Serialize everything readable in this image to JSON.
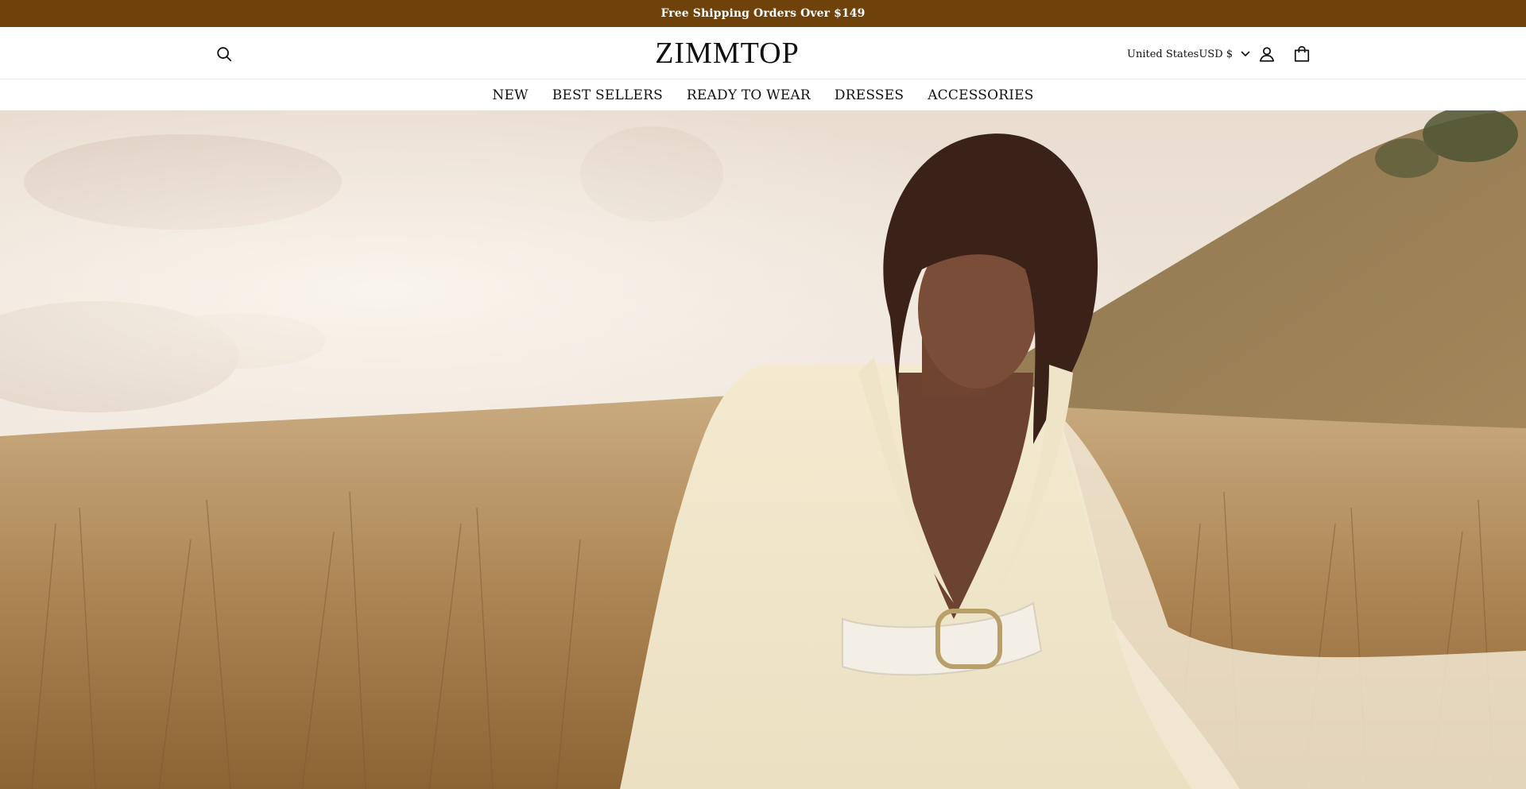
{
  "announcement": {
    "text": "Free Shipping Orders Over $149"
  },
  "header": {
    "logo": "ZIMMTOP",
    "locale": {
      "country": "United States",
      "currency": "USD $"
    },
    "icons": {
      "search": "search-icon",
      "account": "user-icon",
      "cart": "shopping-bag-icon",
      "dropdown": "chevron-down-icon"
    }
  },
  "nav": {
    "items": [
      {
        "label": "NEW"
      },
      {
        "label": "BEST SELLERS"
      },
      {
        "label": "READY TO WEAR"
      },
      {
        "label": "DRESSES"
      },
      {
        "label": "ACCESSORIES"
      }
    ]
  },
  "colors": {
    "announcement_bg": "#6f420c",
    "announcement_text": "#ffffff",
    "header_bg": "#ffffff",
    "text": "#111111"
  }
}
